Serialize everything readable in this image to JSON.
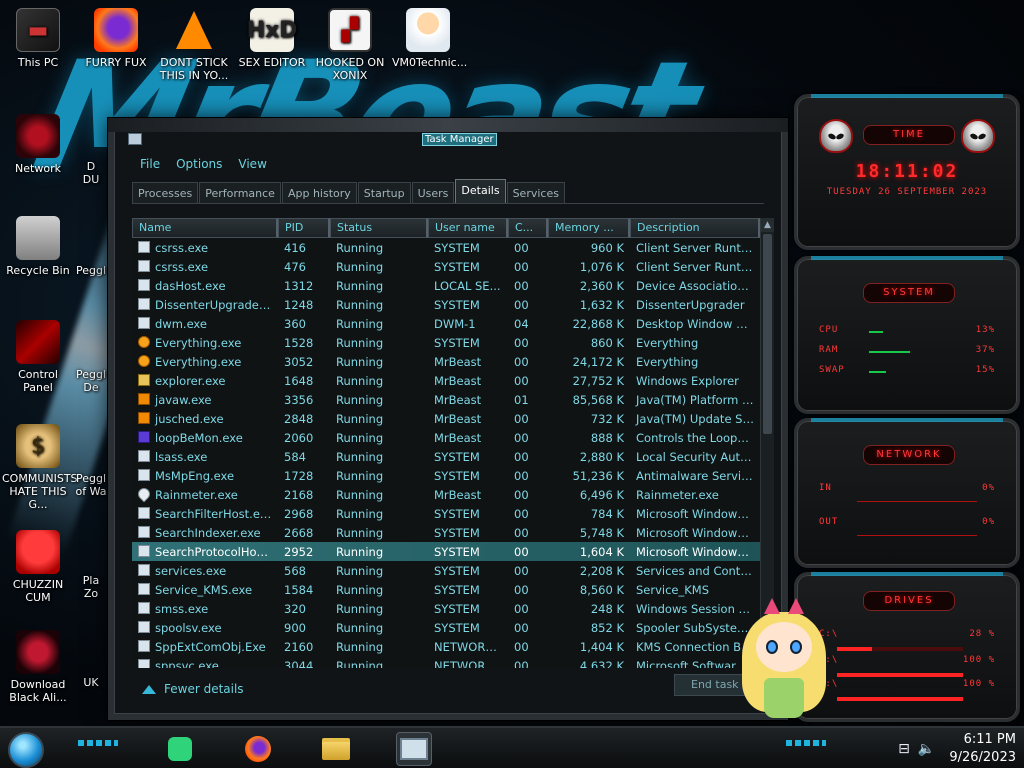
{
  "desktop": {
    "icons": [
      {
        "label": "This PC"
      },
      {
        "label": "FURRY FUX"
      },
      {
        "label": "DONT STICK THIS IN YO..."
      },
      {
        "label": "SEX EDITOR"
      },
      {
        "label": "HOOKED ON XONIX"
      },
      {
        "label": "VM0Technic..."
      },
      {
        "label": "Network"
      },
      {
        "label": "Recycle Bin"
      },
      {
        "label": "Control Panel"
      },
      {
        "label": "COMMUNISTS HATE THIS G..."
      },
      {
        "label": "CHUZZIN CUM"
      },
      {
        "label": "Download Black Ali..."
      }
    ],
    "partial_labels": [
      "D",
      "DU",
      "Peggl",
      "Peggl",
      "De",
      "Peggl",
      "of Wa",
      "Pla",
      "Zo",
      "UK"
    ]
  },
  "task_manager": {
    "title": "Task Manager",
    "menu": [
      "File",
      "Options",
      "View"
    ],
    "tabs": [
      "Processes",
      "Performance",
      "App history",
      "Startup",
      "Users",
      "Details",
      "Services"
    ],
    "active_tab": "Details",
    "columns": [
      "Name",
      "PID",
      "Status",
      "User name",
      "C...",
      "Memory ...",
      "Description"
    ],
    "rows": [
      {
        "name": "csrss.exe",
        "icon": "app",
        "pid": "416",
        "status": "Running",
        "user": "SYSTEM",
        "cpu": "00",
        "mem": "960 K",
        "desc": "Client Server Runtim..."
      },
      {
        "name": "csrss.exe",
        "icon": "app",
        "pid": "476",
        "status": "Running",
        "user": "SYSTEM",
        "cpu": "00",
        "mem": "1,076 K",
        "desc": "Client Server Runtim..."
      },
      {
        "name": "dasHost.exe",
        "icon": "app",
        "pid": "1312",
        "status": "Running",
        "user": "LOCAL SE...",
        "cpu": "00",
        "mem": "2,360 K",
        "desc": "Device Association F..."
      },
      {
        "name": "DissenterUpgrader.exe",
        "icon": "app",
        "pid": "1248",
        "status": "Running",
        "user": "SYSTEM",
        "cpu": "00",
        "mem": "1,632 K",
        "desc": "DissenterUpgrader"
      },
      {
        "name": "dwm.exe",
        "icon": "app",
        "pid": "360",
        "status": "Running",
        "user": "DWM-1",
        "cpu": "04",
        "mem": "22,868 K",
        "desc": "Desktop Window Ma..."
      },
      {
        "name": "Everything.exe",
        "icon": "search",
        "pid": "1528",
        "status": "Running",
        "user": "SYSTEM",
        "cpu": "00",
        "mem": "860 K",
        "desc": "Everything"
      },
      {
        "name": "Everything.exe",
        "icon": "search",
        "pid": "3052",
        "status": "Running",
        "user": "MrBeast",
        "cpu": "00",
        "mem": "24,172 K",
        "desc": "Everything"
      },
      {
        "name": "explorer.exe",
        "icon": "folder",
        "pid": "1648",
        "status": "Running",
        "user": "MrBeast",
        "cpu": "00",
        "mem": "27,752 K",
        "desc": "Windows Explorer"
      },
      {
        "name": "javaw.exe",
        "icon": "java",
        "pid": "3356",
        "status": "Running",
        "user": "MrBeast",
        "cpu": "01",
        "mem": "85,568 K",
        "desc": "Java(TM) Platform S..."
      },
      {
        "name": "jusched.exe",
        "icon": "java",
        "pid": "2848",
        "status": "Running",
        "user": "MrBeast",
        "cpu": "00",
        "mem": "732 K",
        "desc": "Java(TM) Update Sc..."
      },
      {
        "name": "loopBeMon.exe",
        "icon": "loop",
        "pid": "2060",
        "status": "Running",
        "user": "MrBeast",
        "cpu": "00",
        "mem": "888 K",
        "desc": "Controls the LoopBe..."
      },
      {
        "name": "lsass.exe",
        "icon": "app",
        "pid": "584",
        "status": "Running",
        "user": "SYSTEM",
        "cpu": "00",
        "mem": "2,880 K",
        "desc": "Local Security Autho..."
      },
      {
        "name": "MsMpEng.exe",
        "icon": "app",
        "pid": "1728",
        "status": "Running",
        "user": "SYSTEM",
        "cpu": "00",
        "mem": "51,236 K",
        "desc": "Antimalware Service ..."
      },
      {
        "name": "Rainmeter.exe",
        "icon": "drop",
        "pid": "2168",
        "status": "Running",
        "user": "MrBeast",
        "cpu": "00",
        "mem": "6,496 K",
        "desc": "Rainmeter.exe"
      },
      {
        "name": "SearchFilterHost.exe",
        "icon": "app",
        "pid": "2968",
        "status": "Running",
        "user": "SYSTEM",
        "cpu": "00",
        "mem": "784 K",
        "desc": "Microsoft Windows ..."
      },
      {
        "name": "SearchIndexer.exe",
        "icon": "app",
        "pid": "2668",
        "status": "Running",
        "user": "SYSTEM",
        "cpu": "00",
        "mem": "5,748 K",
        "desc": "Microsoft Windows ..."
      },
      {
        "name": "SearchProtocolHost...",
        "icon": "app",
        "pid": "2952",
        "status": "Running",
        "user": "SYSTEM",
        "cpu": "00",
        "mem": "1,604 K",
        "desc": "Microsoft Windows ...",
        "selected": true
      },
      {
        "name": "services.exe",
        "icon": "app",
        "pid": "568",
        "status": "Running",
        "user": "SYSTEM",
        "cpu": "00",
        "mem": "2,208 K",
        "desc": "Services and Control..."
      },
      {
        "name": "Service_KMS.exe",
        "icon": "app",
        "pid": "1584",
        "status": "Running",
        "user": "SYSTEM",
        "cpu": "00",
        "mem": "8,560 K",
        "desc": "Service_KMS"
      },
      {
        "name": "smss.exe",
        "icon": "app",
        "pid": "320",
        "status": "Running",
        "user": "SYSTEM",
        "cpu": "00",
        "mem": "248 K",
        "desc": "Windows Session M..."
      },
      {
        "name": "spoolsv.exe",
        "icon": "app",
        "pid": "900",
        "status": "Running",
        "user": "SYSTEM",
        "cpu": "00",
        "mem": "852 K",
        "desc": "Spooler SubSystem ..."
      },
      {
        "name": "SppExtComObj.Exe",
        "icon": "app",
        "pid": "2160",
        "status": "Running",
        "user": "NETWORK...",
        "cpu": "00",
        "mem": "1,404 K",
        "desc": "KMS Connection Bro..."
      },
      {
        "name": "sppsvc.exe",
        "icon": "app",
        "pid": "3044",
        "status": "Running",
        "user": "NETWORK...",
        "cpu": "00",
        "mem": "4,632 K",
        "desc": "Microsoft Software Pr..."
      }
    ],
    "fewer_details": "Fewer details",
    "end_task": "End task"
  },
  "widgets": {
    "clock": {
      "title": "TIME",
      "time": "18:11:02",
      "date": "Tuesday 26 September 2023"
    },
    "system": {
      "title": "SYSTEM",
      "metrics": [
        {
          "label": "CPU",
          "value": "13%",
          "level": 0.13
        },
        {
          "label": "RAM",
          "value": "37%",
          "level": 0.37
        },
        {
          "label": "SWAP",
          "value": "15%",
          "level": 0.15
        }
      ]
    },
    "network": {
      "title": "NETWORK",
      "rows": [
        {
          "label": "IN",
          "value": "0%"
        },
        {
          "label": "OUT",
          "value": "0%"
        }
      ]
    },
    "drives": {
      "title": "DRIVES",
      "rows": [
        {
          "label": "C:\\",
          "value": "28 %",
          "level": 0.28
        },
        {
          "label": "F:\\",
          "value": "100 %",
          "level": 1.0
        },
        {
          "label": "E:\\",
          "value": "100 %",
          "level": 1.0
        }
      ]
    }
  },
  "taskbar": {
    "time": "6:11 PM",
    "date": "9/26/2023"
  },
  "colors": {
    "accent": "#6ad3e0",
    "selection": "#2f7176",
    "widget_red": "#ff2a2a"
  }
}
